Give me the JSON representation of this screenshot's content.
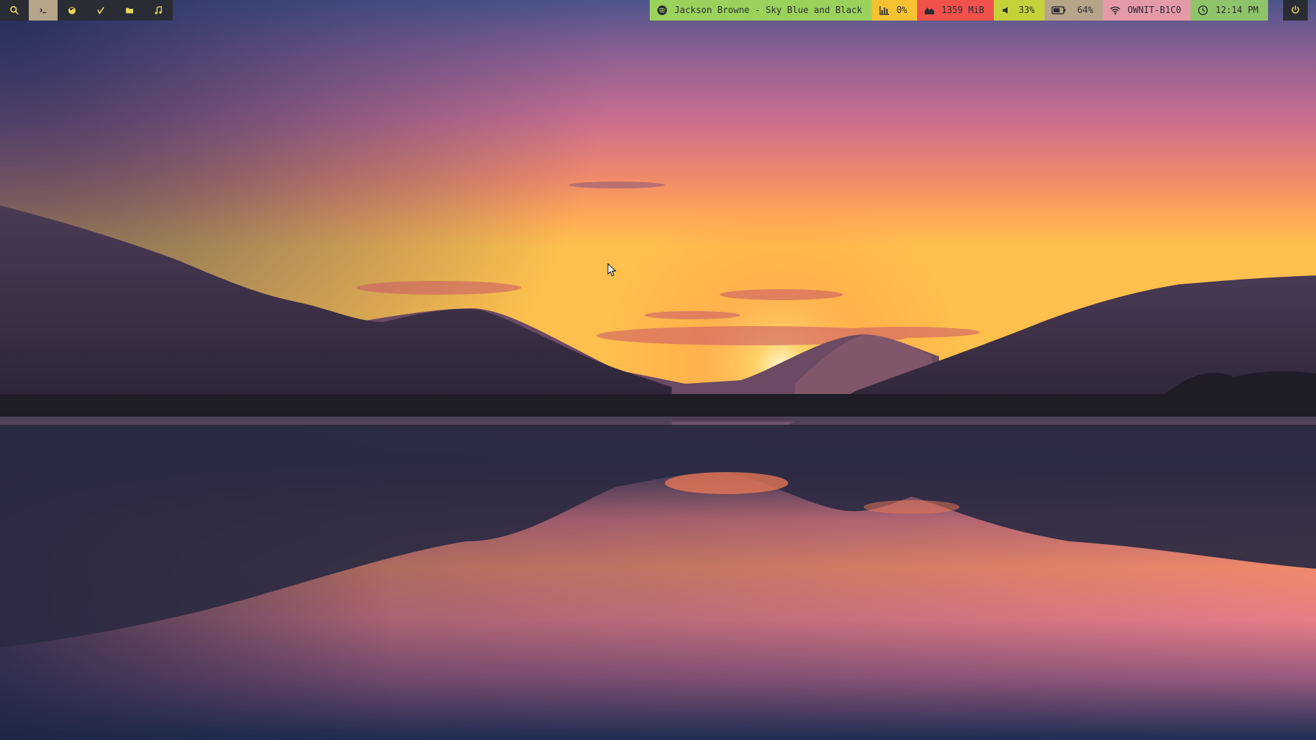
{
  "launcher": {
    "items": [
      {
        "name": "search-icon"
      },
      {
        "name": "terminal-icon"
      },
      {
        "name": "firefox-icon"
      },
      {
        "name": "editor-icon"
      },
      {
        "name": "folder-icon"
      },
      {
        "name": "music-icon"
      }
    ],
    "active_index": 1
  },
  "status": {
    "spotify": {
      "text": "Jackson Browne - Sky Blue and Black",
      "icon": "spotify-icon",
      "color": "#9bd25b"
    },
    "cpu": {
      "text": "0%",
      "icon": "bar-chart-icon",
      "color": "#f6c232"
    },
    "memory": {
      "text": "1359 MiB",
      "icon": "area-chart-icon",
      "color": "#f0514b"
    },
    "volume": {
      "text": "33%",
      "icon": "volume-icon",
      "color": "#c6d23a"
    },
    "battery": {
      "text": "64%",
      "icon": "battery-icon",
      "color": "#b7a58a"
    },
    "wifi": {
      "text": "OWNIT-B1C0",
      "icon": "wifi-icon",
      "color": "#e59aa8"
    },
    "clock": {
      "text": "12:14 PM",
      "icon": "clock-icon",
      "color": "#8fc46a"
    }
  },
  "power": {
    "icon": "power-icon",
    "color": "#e8d65a"
  },
  "wallpaper": {
    "description_colors": [
      "#2c3a6a",
      "#c77aa0",
      "#f59a5e",
      "#ffcf6b"
    ]
  }
}
